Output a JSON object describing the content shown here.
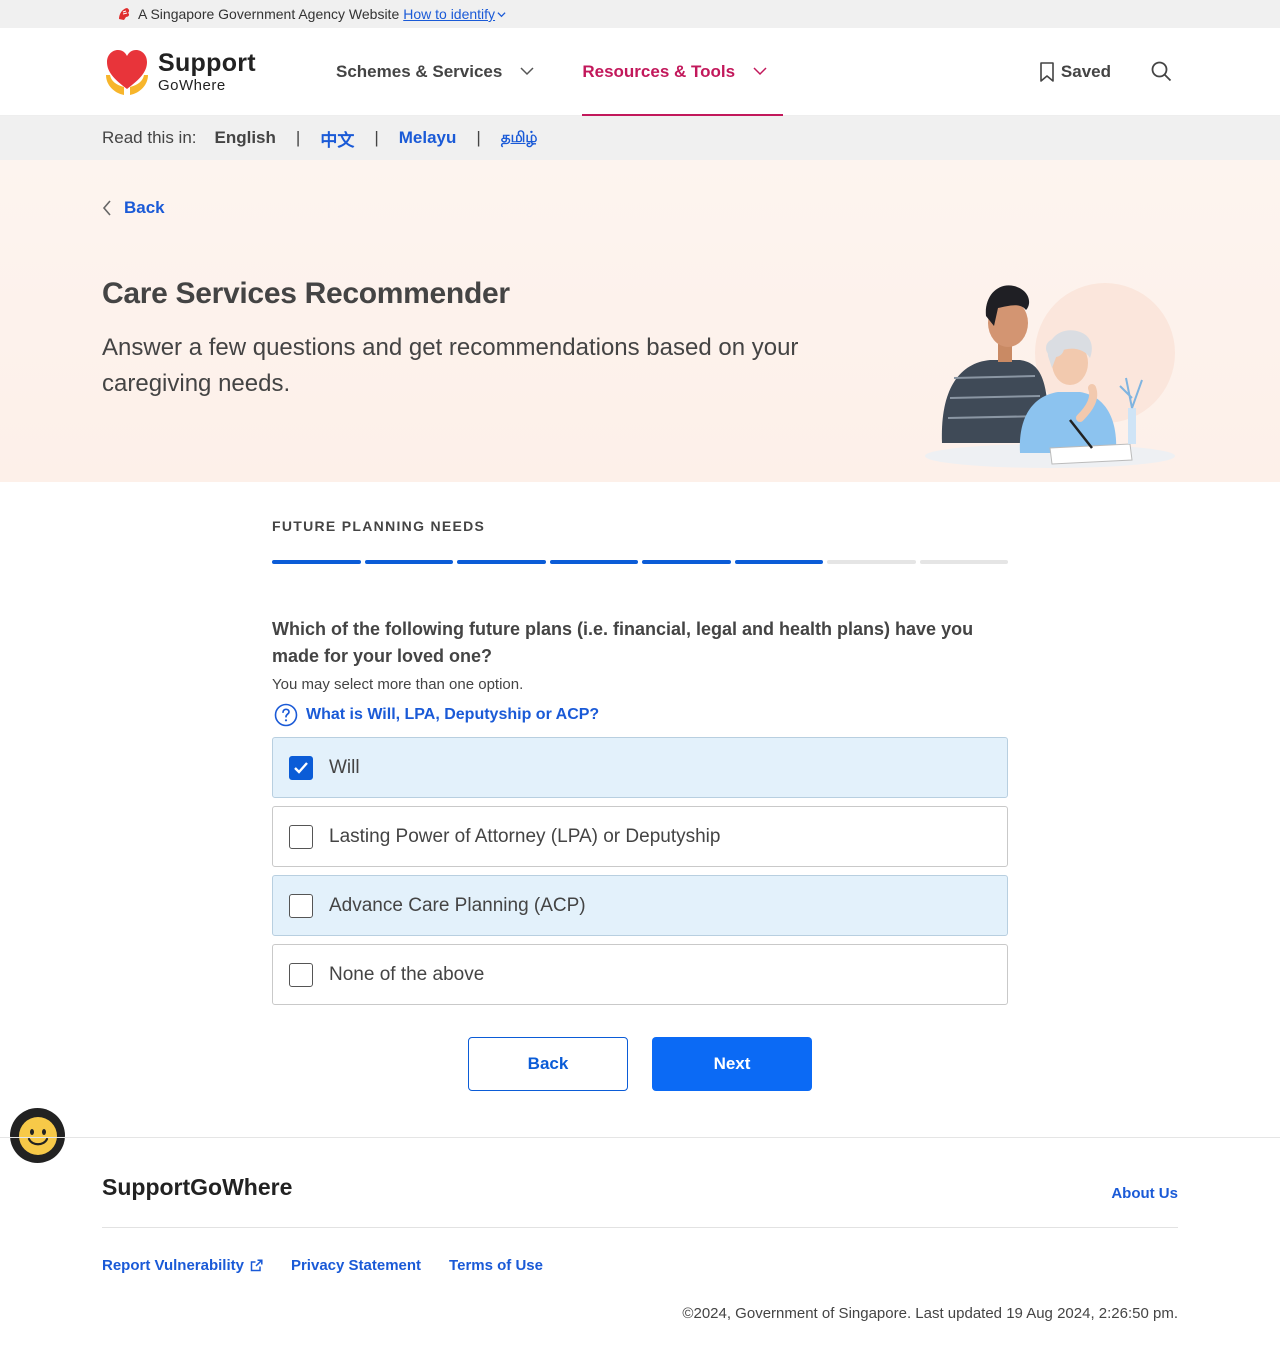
{
  "masthead": {
    "text": "A Singapore Government Agency Website",
    "identify_link": "How to identify"
  },
  "header": {
    "logo_line1": "Support",
    "logo_line2": "GoWhere",
    "nav": [
      {
        "label": "Schemes & Services",
        "active": false
      },
      {
        "label": "Resources & Tools",
        "active": true
      }
    ],
    "saved_label": "Saved"
  },
  "language_bar": {
    "label": "Read this in:",
    "languages": [
      "English",
      "中文",
      "Melayu",
      "தமிழ்"
    ],
    "current": "English"
  },
  "hero": {
    "back_label": "Back",
    "title": "Care Services Recommender",
    "subtitle": "Answer a few questions and get recommendations based on your caregiving needs."
  },
  "form": {
    "section_title": "FUTURE PLANNING NEEDS",
    "progress": {
      "completed": 6,
      "total": 8
    },
    "question": "Which of the following future plans (i.e. financial, legal and health plans) have you made for your loved one?",
    "hint": "You may select more than one option.",
    "help_link": "What is Will, LPA, Deputyship or ACP?",
    "options": [
      {
        "label": "Will",
        "checked": true,
        "highlighted": true
      },
      {
        "label": "Lasting Power of Attorney (LPA) or Deputyship",
        "checked": false,
        "highlighted": false
      },
      {
        "label": "Advance Care Planning (ACP)",
        "checked": false,
        "highlighted": true
      },
      {
        "label": "None of the above",
        "checked": false,
        "highlighted": false
      }
    ],
    "back_button": "Back",
    "next_button": "Next"
  },
  "footer": {
    "brand": "SupportGoWhere",
    "about": "About Us",
    "links": [
      "Report Vulnerability",
      "Privacy Statement",
      "Terms of Use"
    ],
    "copyright": "©2024, Government of Singapore. Last updated 19 Aug 2024, 2:26:50 pm."
  },
  "colors": {
    "accent_blue": "#0b5cd7",
    "active_nav": "#c2185b",
    "hero_bg": "#fdf4ef",
    "highlight_option": "#e3f1fb"
  }
}
